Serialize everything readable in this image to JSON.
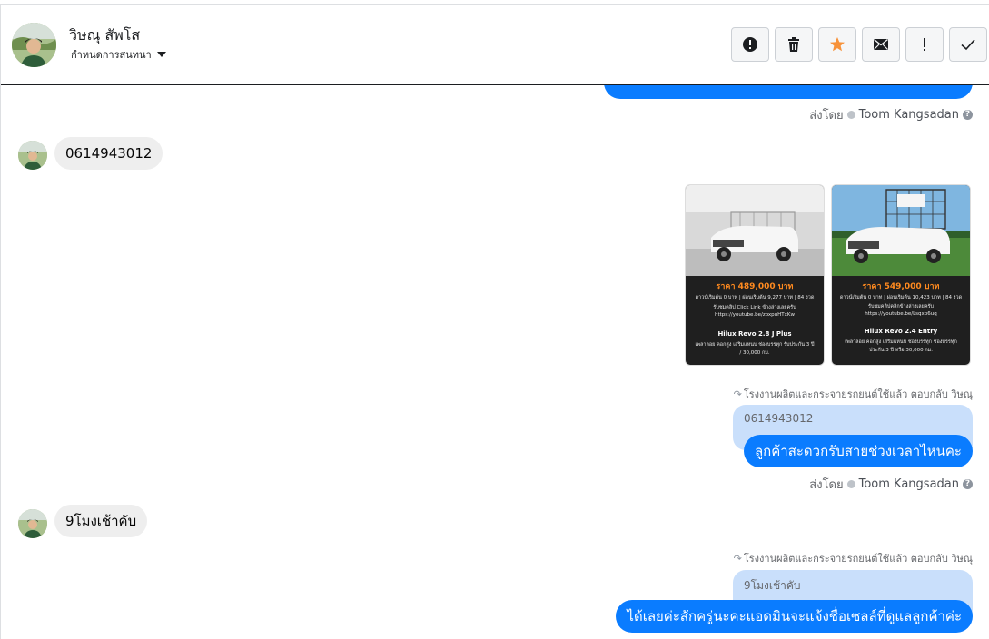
{
  "header": {
    "contact_name": "วิษณุ สัพโส",
    "assign_label": "กำหนดการสนทนา",
    "actions": [
      {
        "icon": "alert-circle-icon"
      },
      {
        "icon": "trash-icon"
      },
      {
        "icon": "star-icon"
      },
      {
        "icon": "mail-icon"
      },
      {
        "icon": "exclamation-icon"
      },
      {
        "icon": "check-icon"
      }
    ],
    "star_color": "#f7923a"
  },
  "messages": {
    "sent_by_1": {
      "prefix": "ส่งโดย",
      "agent": "Toom Kangsadan"
    },
    "customer_1": {
      "text": "0614943012"
    },
    "cars": [
      {
        "price": "ราคา 489,000 บาท",
        "line1": "ดาวน์เริ่มต้น 0 บาท | ผ่อนเริ่มต้น 9,277 บาท | 84 งวด",
        "line2": "รับชมคลิป Click Link ข้างล่างเลยครับ",
        "line3": "https://youtube.be/zoxpuHTxKw",
        "model": "Hilux Revo 2.8 J Plus",
        "line4": "เพลาลอย คอกสูง เสริมแหนบ ช่องบรรทุก รับประกัน 3 ปี",
        "line5": "/ 30,000 กม."
      },
      {
        "price": "ราคา 549,000 บาท",
        "line1": "ดาวน์เริ่มต้น 0 บาท | ผ่อนเริ่มต้น 10,423 บาท | 84 งวด",
        "line2": "รับชมคลิปคลิกข้างล่างเลยครับ",
        "line3": "https://youtube.be/Lsqxp6uq",
        "model": "Hilux Revo 2.4 Entry",
        "line4": "เพลาลอย คอกสูง เสริมแหนบ ช่องบรรทุก ช่องบรรทุก",
        "line5": "ประกัน 3 ปี หรือ 30,000 กม."
      }
    ],
    "reply_note_1": "โรงงานผลิตและกระจายรถยนต์ใช้แล้ว ตอบกลับ วิษณุ",
    "quoted_1": "0614943012",
    "reply_1": "ลูกค้าสะดวกรับสายช่วงเวลาไหนคะ",
    "sent_by_2": {
      "prefix": "ส่งโดย",
      "agent": "Toom Kangsadan"
    },
    "customer_2": {
      "text": "9โมงเช้าคับ"
    },
    "reply_note_2": "โรงงานผลิตและกระจายรถยนต์ใช้แล้ว ตอบกลับ วิษณุ",
    "quoted_2": "9โมงเช้าคับ",
    "reply_2": "ได้เลยค่ะสักครู่นะคะแอดมินจะแจ้งชื่อเซลล์ที่ดูแลลูกค้าค่ะ"
  },
  "colors": {
    "accent_blue": "#0a7cff",
    "quoted_bg": "#c9dffb",
    "customer_bubble": "#eeeeee"
  }
}
